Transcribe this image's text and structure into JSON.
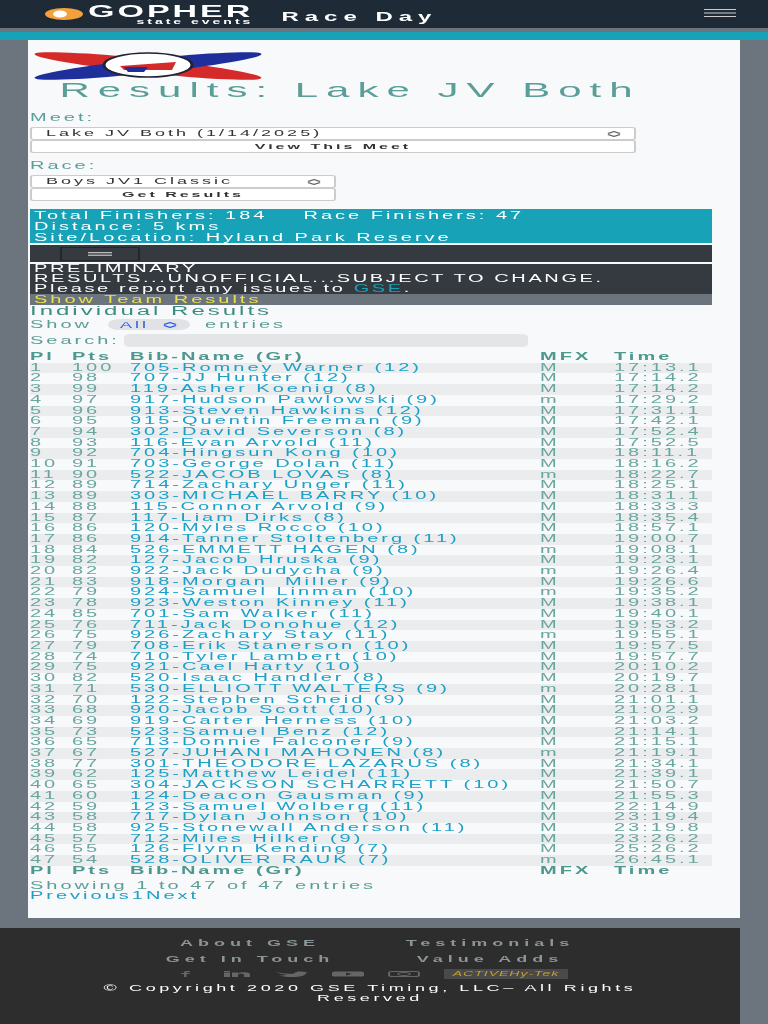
{
  "header": {
    "brand": "GOPHER",
    "brand_sub": "state events",
    "title": "Race Day"
  },
  "page_title": "Results: Lake JV Both",
  "meet": {
    "label": "Meet:",
    "value": "Lake JV Both (1/14/2025)",
    "button": "View This Meet"
  },
  "race": {
    "label": "Race:",
    "value": "Boys JV1 Classic",
    "button": "Get Results"
  },
  "info": {
    "total": "Total Finishers: 184",
    "race_total": "Race Finishers: 47",
    "distance": "Distance: 5 kms",
    "site": "Site/Location: Hyland Park Reserve"
  },
  "notice": {
    "lines": [
      "PRELIMINARY",
      "RESULTS...UNOFFICIAL...SUBJECT TO CHANGE."
    ],
    "report": "Please report any issues to ",
    "link": "GSE",
    "after": "."
  },
  "team_results_link": "Show Team Results",
  "individual": {
    "heading": "Individual Results",
    "show_label": "Show",
    "page_size": "All",
    "entries_label": "entries",
    "search_label": "Search:",
    "columns": [
      "Pl",
      "Pts",
      "Bib-Name (Gr)",
      "MFX",
      "Time"
    ],
    "rows": [
      {
        "pl": "1",
        "pts": "100",
        "name": "705-Romney Warner (12)",
        "mfx": "M",
        "time": "17:13.1"
      },
      {
        "pl": "2",
        "pts": "98",
        "name": "707-JJ Hunter (12)",
        "mfx": "M",
        "time": "17:14.2"
      },
      {
        "pl": "3",
        "pts": "99",
        "name": "119-Asher Koenig (8)",
        "mfx": "M",
        "time": "17:14.2"
      },
      {
        "pl": "4",
        "pts": "97",
        "name": "917-Hudson Pawlowski (9)",
        "mfx": "m",
        "time": "17:29.2"
      },
      {
        "pl": "5",
        "pts": "96",
        "name": "913-Steven Hawkins (12)",
        "mfx": "M",
        "time": "17:31.1"
      },
      {
        "pl": "6",
        "pts": "95",
        "name": "915-Quentin Freeman (9)",
        "mfx": "M",
        "time": "17:42.1"
      },
      {
        "pl": "7",
        "pts": "94",
        "name": "302-David Severson (8)",
        "mfx": "M",
        "time": "17:52.4"
      },
      {
        "pl": "8",
        "pts": "93",
        "name": "116-Evan Arvold (11)",
        "mfx": "M",
        "time": "17:52.5"
      },
      {
        "pl": "9",
        "pts": "92",
        "name": "704-Hingsun Kong (10)",
        "mfx": "M",
        "time": "18:11.1"
      },
      {
        "pl": "10",
        "pts": "91",
        "name": "703-George Dolan (11)",
        "mfx": "M",
        "time": "18:16.2"
      },
      {
        "pl": "11",
        "pts": "90",
        "name": "522-JACOB LOVAS (8)",
        "mfx": "m",
        "time": "18:22.7"
      },
      {
        "pl": "12",
        "pts": "89",
        "name": "714-Zachary Unger (11)",
        "mfx": "M",
        "time": "18:25.1"
      },
      {
        "pl": "13",
        "pts": "89",
        "name": "303-MICHAEL BARRY (10)",
        "mfx": "M",
        "time": "18:31.1"
      },
      {
        "pl": "14",
        "pts": "88",
        "name": "115-Connor Arvold (9)",
        "mfx": "M",
        "time": "18:33.3"
      },
      {
        "pl": "15",
        "pts": "87",
        "name": "117-Liam Dirks (8)",
        "mfx": "M",
        "time": "18:35.4"
      },
      {
        "pl": "16",
        "pts": "86",
        "name": "120-Myles Rocco (10)",
        "mfx": "M",
        "time": "18:57.1"
      },
      {
        "pl": "17",
        "pts": "86",
        "name": "914-Tanner Stoltenberg (11)",
        "mfx": "M",
        "time": "19:00.7"
      },
      {
        "pl": "18",
        "pts": "84",
        "name": "526-EMMETT HAGEN (8)",
        "mfx": "m",
        "time": "19:08.1"
      },
      {
        "pl": "19",
        "pts": "82",
        "name": "127-Jacob Hruska (9)",
        "mfx": "M",
        "time": "19:23.1"
      },
      {
        "pl": "20",
        "pts": "82",
        "name": "922-Jack Dudycha (9)",
        "mfx": "m",
        "time": "19:26.4"
      },
      {
        "pl": "21",
        "pts": "83",
        "name": "918-Morgan  Miller (9)",
        "mfx": "M",
        "time": "19:26.6"
      },
      {
        "pl": "22",
        "pts": "79",
        "name": "924-Samuel Linman (10)",
        "mfx": "m",
        "time": "19:35.2"
      },
      {
        "pl": "23",
        "pts": "78",
        "name": "923-Weston Kinney (11)",
        "mfx": "M",
        "time": "19:38.1"
      },
      {
        "pl": "24",
        "pts": "85",
        "name": "701-Sam Walker (11)",
        "mfx": "M",
        "time": "19:40.1"
      },
      {
        "pl": "25",
        "pts": "76",
        "name": "711-Jack Donohue (12)",
        "mfx": "M",
        "time": "19:53.2"
      },
      {
        "pl": "26",
        "pts": "75",
        "name": "926-Zachary Stay (11)",
        "mfx": "m",
        "time": "19:55.1"
      },
      {
        "pl": "27",
        "pts": "79",
        "name": "708-Erik Stanerson (10)",
        "mfx": "M",
        "time": "19:57.5"
      },
      {
        "pl": "28",
        "pts": "74",
        "name": "710-Tyler Lambert (10)",
        "mfx": "M",
        "time": "19:57.7"
      },
      {
        "pl": "29",
        "pts": "75",
        "name": "921-Cael Harty (10)",
        "mfx": "M",
        "time": "20:10.2"
      },
      {
        "pl": "30",
        "pts": "82",
        "name": "520-Isaac Handler (8)",
        "mfx": "M",
        "time": "20:19.7"
      },
      {
        "pl": "31",
        "pts": "71",
        "name": "530-ELLIOTT WALTERS (9)",
        "mfx": "m",
        "time": "20:28.1"
      },
      {
        "pl": "32",
        "pts": "70",
        "name": "122-Stephen Scheid (9)",
        "mfx": "M",
        "time": "21:01.1"
      },
      {
        "pl": "33",
        "pts": "68",
        "name": "920-Jacob Scott (10)",
        "mfx": "M",
        "time": "21:02.9"
      },
      {
        "pl": "34",
        "pts": "69",
        "name": "919-Carter Herness (10)",
        "mfx": "M",
        "time": "21:03.2"
      },
      {
        "pl": "35",
        "pts": "73",
        "name": "523-Samuel Benz (12)",
        "mfx": "M",
        "time": "21:14.1"
      },
      {
        "pl": "36",
        "pts": "65",
        "name": "713-Donnie Falconer (9)",
        "mfx": "M",
        "time": "21:15.1"
      },
      {
        "pl": "37",
        "pts": "67",
        "name": "527-JUHANI MAHONEN (8)",
        "mfx": "m",
        "time": "21:19.1"
      },
      {
        "pl": "38",
        "pts": "77",
        "name": "301-THEODORE LAZARUS (8)",
        "mfx": "M",
        "time": "21:34.1"
      },
      {
        "pl": "39",
        "pts": "62",
        "name": "125-Matthew Leidel (11)",
        "mfx": "M",
        "time": "21:39.1"
      },
      {
        "pl": "40",
        "pts": "65",
        "name": "304-JACKSON SCHARRETT (10)",
        "mfx": "M",
        "time": "21:50.7"
      },
      {
        "pl": "41",
        "pts": "60",
        "name": "124-Deacon Gausman (9)",
        "mfx": "M",
        "time": "21:55.3"
      },
      {
        "pl": "42",
        "pts": "59",
        "name": "123-Samuel Wolberg (11)",
        "mfx": "M",
        "time": "22:14.9"
      },
      {
        "pl": "43",
        "pts": "58",
        "name": "717-Dylan Johnson (10)",
        "mfx": "M",
        "time": "23:19.4"
      },
      {
        "pl": "44",
        "pts": "58",
        "name": "925-Stonewall Anderson (11)",
        "mfx": "M",
        "time": "23:19.8"
      },
      {
        "pl": "45",
        "pts": "57",
        "name": "712-Miles Hilker (9)",
        "mfx": "M",
        "time": "23:26.2"
      },
      {
        "pl": "46",
        "pts": "55",
        "name": "126-Flynn Kending (7)",
        "mfx": "M",
        "time": "25:26.2"
      },
      {
        "pl": "47",
        "pts": "54",
        "name": "528-OLIVER RAUK (7)",
        "mfx": "m",
        "time": "26:45.1"
      }
    ],
    "footer_columns": [
      "Pl",
      "Pts",
      "Bib-Name (Gr)",
      "MFX",
      "Time"
    ],
    "summary": "Showing 1 to 47 of 47 entries",
    "pagination": [
      "Previous",
      "1",
      "Next"
    ]
  },
  "footer": {
    "links": [
      "About GSE",
      "Testimonials",
      "Get In Touch",
      "Value Adds"
    ],
    "partner": "ACTIVEHy-Tek",
    "copyright": "© Copyright 2020 GSE Timing, LLC– All Rights Reserved"
  }
}
